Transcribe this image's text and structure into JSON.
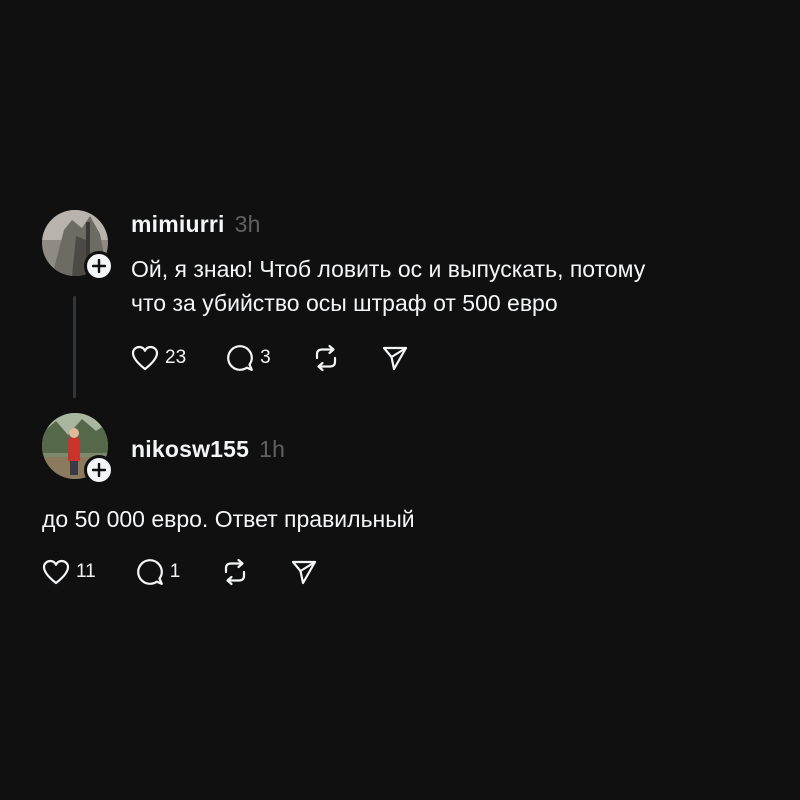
{
  "posts": [
    {
      "username": "mimiurri",
      "time": "3h",
      "lines": [
        "Ой, я знаю! Чтоб ловить ос и выпускать, потому",
        "что за убийство осы штраф от 500 евро"
      ],
      "likes": "23",
      "replies": "3"
    },
    {
      "username": "nikosw155",
      "time": "1h",
      "lines": [
        "до 50 000 евро. Ответ правильный"
      ],
      "likes": "11",
      "replies": "1"
    }
  ],
  "icons": {
    "like": "heart-icon",
    "reply": "comment-icon",
    "repost": "repost-icon",
    "share": "send-icon",
    "follow": "plus-icon"
  },
  "colors": {
    "background": "#101010",
    "text": "#f3f5f7",
    "muted": "#616161",
    "thread_line": "#333638"
  }
}
